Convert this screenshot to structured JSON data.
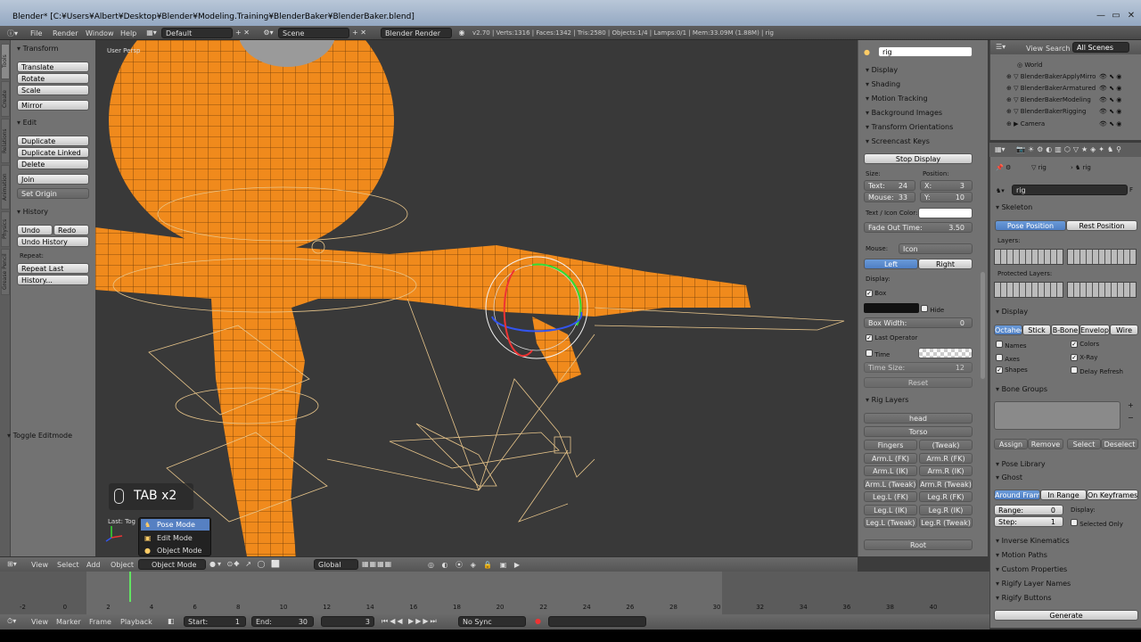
{
  "titlebar": {
    "title": "Blender* [C:¥Users¥Albert¥Desktop¥Blender¥Modeling.Training¥BlenderBaker¥BlenderBaker.blend]"
  },
  "infobar": {
    "menus": [
      "File",
      "Render",
      "Window",
      "Help"
    ],
    "layout": "Default",
    "scene": "Scene",
    "engine": "Blender Render",
    "stats": "v2.70 | Verts:1316 | Faces:1342 | Tris:2580 | Objects:1/4 | Lamps:0/1 | Mem:33.09M (1.88M) | rig"
  },
  "toolshelf": {
    "tabs": [
      "Tools",
      "Create",
      "Relations",
      "Animation",
      "Physics",
      "Grease Pencil"
    ],
    "transform": {
      "title": "Transform",
      "buttons": [
        "Translate",
        "Rotate",
        "Scale",
        "Mirror"
      ]
    },
    "edit": {
      "title": "Edit",
      "buttons": [
        "Duplicate",
        "Duplicate Linked",
        "Delete",
        "Join",
        "Set Origin"
      ]
    },
    "history": {
      "title": "History",
      "undo": "Undo",
      "redo": "Redo",
      "undo_history": "Undo History",
      "repeat_label": "Repeat:",
      "repeat_last": "Repeat Last",
      "history_btn": "History..."
    },
    "operator": "Toggle Editmode"
  },
  "viewport": {
    "label": "User Persp",
    "screencast": "TAB x2",
    "last_op": "Last: Tog",
    "mode_menu": [
      "Pose Mode",
      "Edit Mode",
      "Object Mode"
    ]
  },
  "view_header": {
    "menus": [
      "View",
      "Select",
      "Add",
      "Object"
    ],
    "mode": "Object Mode",
    "orientation": "Global"
  },
  "props": {
    "object": "rig",
    "panels": [
      "Display",
      "Shading",
      "Motion Tracking",
      "Background Images",
      "Transform Orientations",
      "Screencast Keys"
    ],
    "stop_display": "Stop Display",
    "size_label": "Size:",
    "position_label": "Position:",
    "text": "Text:",
    "text_val": "24",
    "mouse": "Mouse:",
    "mouse_val": "33",
    "x": "X:",
    "x_val": "3",
    "y": "Y:",
    "y_val": "10",
    "color_label": "Text / Icon Color:",
    "fade": "Fade Out Time:",
    "fade_val": "3.50",
    "mouse_mode_label": "Mouse:",
    "mouse_mode": "Icon",
    "left": "Left",
    "right": "Right",
    "display_label": "Display:",
    "box": "Box",
    "hide": "Hide",
    "box_width": "Box Width:",
    "box_width_val": "0",
    "last_operator": "Last Operator",
    "time": "Time",
    "time_size": "Time Size:",
    "time_size_val": "12",
    "reset": "Reset",
    "rig_layers": "Rig Layers",
    "rig_buttons": [
      [
        "head"
      ],
      [
        "Torso"
      ],
      [
        "Fingers",
        "(Tweak)"
      ],
      [
        "Arm.L (FK)",
        "Arm.R (FK)"
      ],
      [
        "Arm.L (IK)",
        "Arm.R (IK)"
      ],
      [
        "Arm.L (Tweak)",
        "Arm.R (Tweak)"
      ],
      [
        "Leg.L (FK)",
        "Leg.R (FK)"
      ],
      [
        "Leg.L (IK)",
        "Leg.R (IK)"
      ],
      [
        "Leg.L (Tweak)",
        "Leg.R (Tweak)"
      ],
      [
        "Root"
      ]
    ]
  },
  "outliner": {
    "menus": [
      "View",
      "Search",
      "All Scenes"
    ],
    "items": [
      "World",
      "BlenderBakerApplyMirro",
      "BlenderBakerArmatured",
      "BlenderBakerModeling",
      "BlenderBakerRigging",
      "Camera"
    ]
  },
  "properties": {
    "breadcrumb": [
      "rig",
      "rig"
    ],
    "name": "rig",
    "skeleton": "Skeleton",
    "pose_position": "Pose Position",
    "rest_position": "Rest Position",
    "layers": "Layers:",
    "protected_layers": "Protected Layers:",
    "display": "Display",
    "display_types": [
      "Octahedral",
      "Stick",
      "B-Bone",
      "Envelope",
      "Wire"
    ],
    "names": "Names",
    "colors": "Colors",
    "axes": "Axes",
    "xray": "X-Ray",
    "shapes": "Shapes",
    "delay_refresh": "Delay Refresh",
    "bone_groups": "Bone Groups",
    "bg_buttons": [
      "Assign",
      "Remove",
      "Select",
      "Deselect"
    ],
    "pose_library": "Pose Library",
    "ghost": "Ghost",
    "ghost_types": [
      "Around Frame",
      "In Range",
      "On Keyframes"
    ],
    "range": "Range:",
    "range_val": "0",
    "step": "Step:",
    "step_val": "1",
    "ghost_display": "Display:",
    "selected_only": "Selected Only",
    "collapsed": [
      "Inverse Kinematics",
      "Motion Paths",
      "Custom Properties",
      "Rigify Layer Names",
      "Rigify Buttons"
    ],
    "generate": "Generate"
  },
  "timeline": {
    "ticks": [
      "-2",
      "0",
      "2",
      "4",
      "6",
      "8",
      "10",
      "12",
      "14",
      "16",
      "18",
      "20",
      "22",
      "24",
      "26",
      "28",
      "30",
      "32",
      "34",
      "36",
      "38",
      "40"
    ],
    "menus": [
      "View",
      "Marker",
      "Frame",
      "Playback"
    ],
    "start": "Start:",
    "start_val": "1",
    "end": "End:",
    "end_val": "30",
    "current": "3",
    "sync": "No Sync"
  },
  "colors": {
    "accent": "#5680c2",
    "mesh": "#f08a1c"
  }
}
